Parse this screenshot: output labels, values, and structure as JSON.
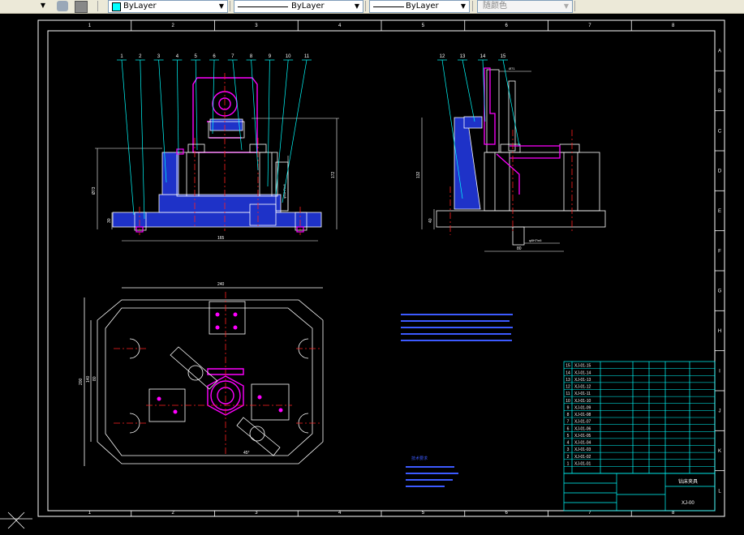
{
  "toolbar": {
    "color_control": {
      "value": "ByLayer",
      "swatch": "#00ffff"
    },
    "linetype_control": {
      "value": "ByLayer"
    },
    "lineweight_control": {
      "value": "ByLayer"
    },
    "plotstyle_control": {
      "value": "随颜色"
    }
  },
  "drawing": {
    "frame_columns": [
      "1",
      "2",
      "3",
      "4",
      "5",
      "6",
      "7",
      "8"
    ],
    "frame_rows": [
      "A",
      "B",
      "C",
      "D",
      "E",
      "F",
      "G",
      "H",
      "I",
      "J",
      "K",
      "L"
    ],
    "balloons_front": [
      "1",
      "2",
      "3",
      "4",
      "5",
      "6",
      "7",
      "8",
      "9",
      "10",
      "11"
    ],
    "balloons_side": [
      "12",
      "13",
      "14",
      "15"
    ],
    "dimensions": {
      "front_width": "165",
      "front_height": "172",
      "front_left_height": "Ø73",
      "front_right_height": "φ90H7/n6",
      "front_base": "30",
      "side_height": "132",
      "side_base": "40",
      "side_width": "80",
      "side_fit": "φ8H7/n6",
      "side_top": "Ø71",
      "top_width": "240",
      "top_height": "200",
      "top_inner": "140",
      "top_inner2": "80",
      "top_angle": "45°"
    },
    "tech_notes_title": "技术要求",
    "title_block": {
      "drawing_title": "钻床夹具",
      "drawing_number": "XJ-00"
    },
    "parts_list": [
      [
        "15",
        "XJ-01-15"
      ],
      [
        "14",
        "XJ-01-14"
      ],
      [
        "13",
        "XJ-01-13"
      ],
      [
        "12",
        "XJ-01-12"
      ],
      [
        "11",
        "XJ-01-11"
      ],
      [
        "10",
        "XJ-01-10"
      ],
      [
        "9",
        "XJ-01-09"
      ],
      [
        "8",
        "XJ-01-08"
      ],
      [
        "7",
        "XJ-01-07"
      ],
      [
        "6",
        "XJ-01-06"
      ],
      [
        "5",
        "XJ-01-05"
      ],
      [
        "4",
        "XJ-01-04"
      ],
      [
        "3",
        "XJ-01-03"
      ],
      [
        "2",
        "XJ-01-02"
      ],
      [
        "1",
        "XJ-01-01"
      ]
    ]
  },
  "colors": {
    "background": "#000000",
    "frame": "#ffffff",
    "leader": "#00ffff",
    "part_fill": "#1e32c8",
    "magenta": "#ff00ff",
    "centerline": "#ff2020",
    "dimension": "#ffffff",
    "tech_text": "#3c5aff",
    "table_lines": "#00ffff"
  }
}
